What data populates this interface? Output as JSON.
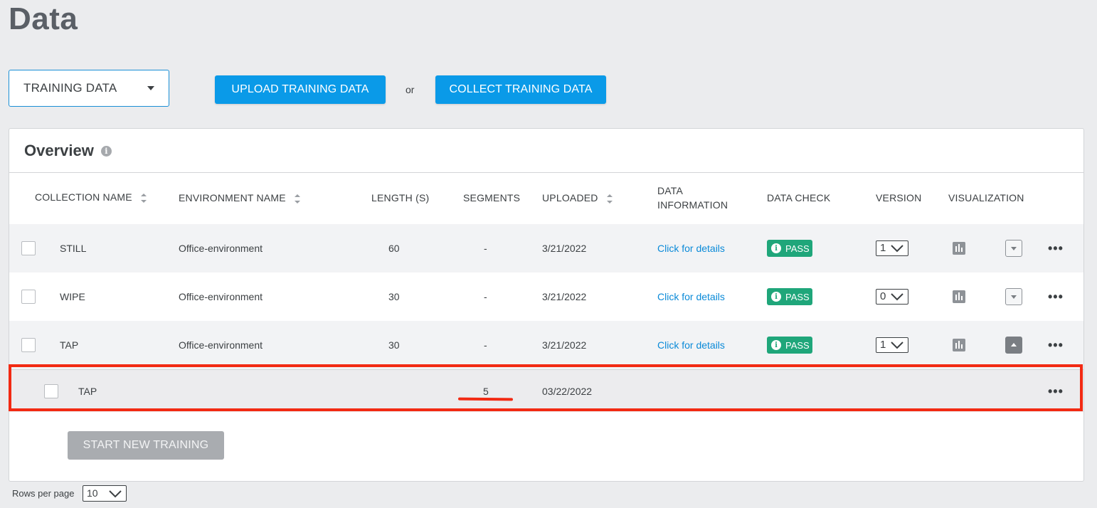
{
  "page": {
    "title": "Data"
  },
  "toolbar": {
    "dataset_select": "TRAINING DATA",
    "upload_label": "UPLOAD TRAINING DATA",
    "or_label": "or",
    "collect_label": "COLLECT TRAINING DATA"
  },
  "overview": {
    "title": "Overview",
    "info_icon": "info-icon",
    "columns": {
      "collection_name": "COLLECTION NAME",
      "environment_name": "ENVIRONMENT NAME",
      "length": "LENGTH (S)",
      "segments": "SEGMENTS",
      "uploaded": "UPLOADED",
      "data_information": "DATA INFORMATION",
      "data_check": "DATA CHECK",
      "version": "VERSION",
      "visualization": "VISUALIZATION"
    },
    "rows": [
      {
        "name": "STILL",
        "environment": "Office-environment",
        "length": "60",
        "segments": "-",
        "uploaded": "3/21/2022",
        "info": "Click for details",
        "check": "PASS",
        "version": "1"
      },
      {
        "name": "WIPE",
        "environment": "Office-environment",
        "length": "30",
        "segments": "-",
        "uploaded": "3/21/2022",
        "info": "Click for details",
        "check": "PASS",
        "version": "0"
      },
      {
        "name": "TAP",
        "environment": "Office-environment",
        "length": "30",
        "segments": "-",
        "uploaded": "3/21/2022",
        "info": "Click for details",
        "check": "PASS",
        "version": "1"
      }
    ],
    "subrow": {
      "name": "TAP",
      "segments": "5",
      "uploaded": "03/22/2022"
    },
    "start_training_label": "START NEW TRAINING"
  },
  "pagination": {
    "rows_per_page_label": "Rows per page",
    "rows_per_page_value": "10"
  },
  "colors": {
    "accent": "#0a9ae8",
    "pass": "#1fa67a",
    "highlight": "#f22a13",
    "link": "#0a8ad8"
  }
}
